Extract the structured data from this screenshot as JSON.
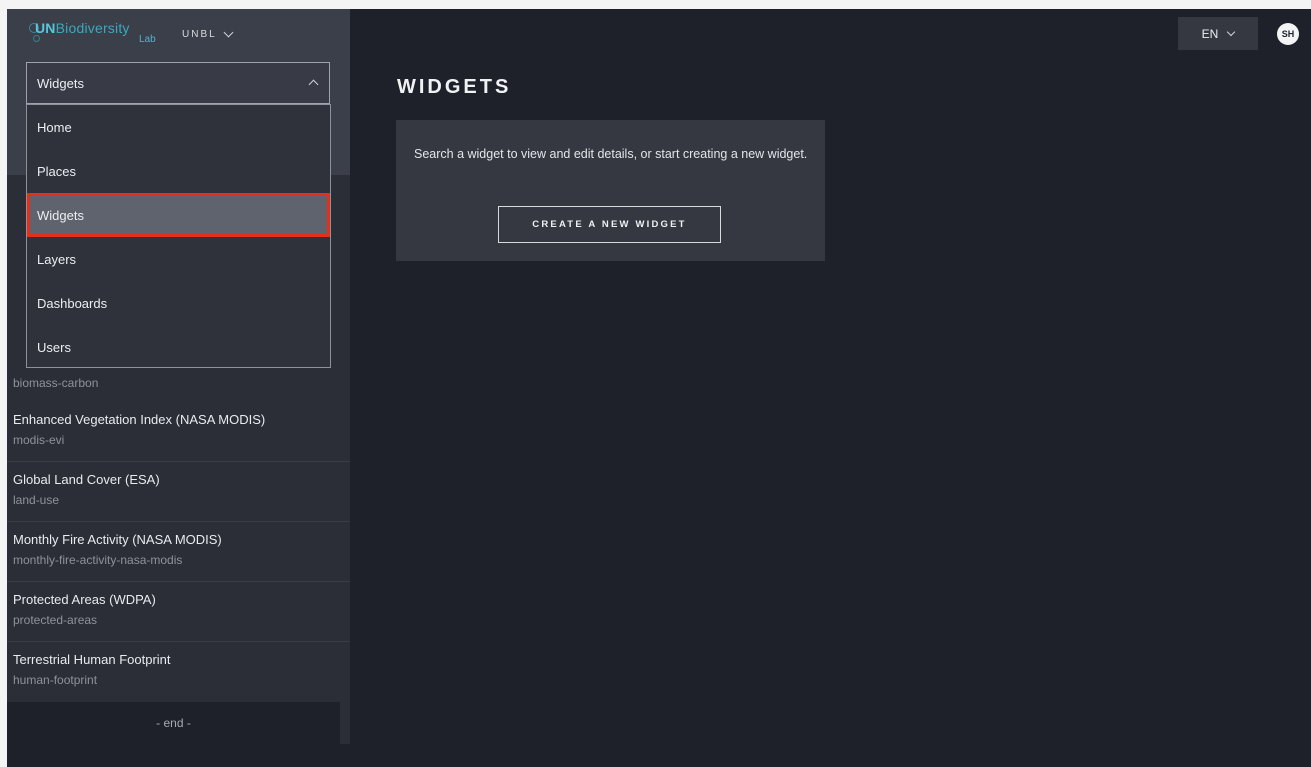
{
  "logo": {
    "un": "UN",
    "biodiversity": "Biodiversity",
    "lab": "Lab"
  },
  "org_select": {
    "value": "UNBL"
  },
  "nav": {
    "selected": "Widgets",
    "items": [
      {
        "label": "Home"
      },
      {
        "label": "Places"
      },
      {
        "label": "Widgets",
        "active": true
      },
      {
        "label": "Layers"
      },
      {
        "label": "Dashboards"
      },
      {
        "label": "Users"
      }
    ]
  },
  "layers": {
    "partial_slug": "biomass-carbon",
    "items": [
      {
        "name": "Enhanced Vegetation Index (NASA MODIS)",
        "slug": "modis-evi"
      },
      {
        "name": "Global Land Cover (ESA)",
        "slug": "land-use"
      },
      {
        "name": "Monthly Fire Activity (NASA MODIS)",
        "slug": "monthly-fire-activity-nasa-modis"
      },
      {
        "name": "Protected Areas (WDPA)",
        "slug": "protected-areas"
      },
      {
        "name": "Terrestrial Human Footprint",
        "slug": "human-footprint"
      }
    ],
    "end_label": "- end -"
  },
  "main": {
    "title": "WIDGETS",
    "info_text": "Search a widget to view and edit details, or start creating a new widget.",
    "create_button": "CREATE A NEW WIDGET"
  },
  "header": {
    "language": "EN",
    "avatar_initials": "SH"
  },
  "colors": {
    "highlight": "#e2301c",
    "brand": "#3aa9bf",
    "background": "#1f212a"
  }
}
